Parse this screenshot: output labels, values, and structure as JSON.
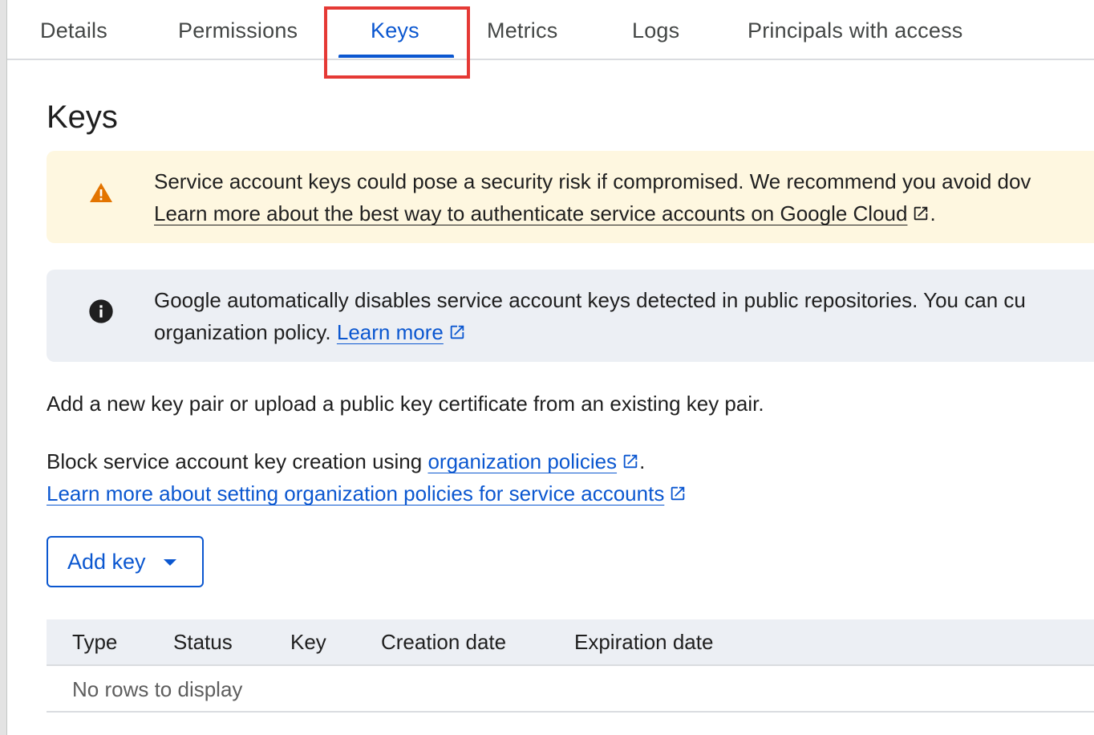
{
  "tabs": [
    {
      "label": "Details"
    },
    {
      "label": "Permissions"
    },
    {
      "label": "Keys"
    },
    {
      "label": "Metrics"
    },
    {
      "label": "Logs"
    },
    {
      "label": "Principals with access"
    }
  ],
  "active_tab": "Keys",
  "page_title": "Keys",
  "warning_banner": {
    "icon": "warning-icon",
    "text": "Service account keys could pose a security risk if compromised. We recommend you avoid dov",
    "link_text": "Learn more about the best way to authenticate service accounts on Google Cloud",
    "after_link": "."
  },
  "info_banner": {
    "icon": "info-icon",
    "text": "Google automatically disables service account keys detected in public repositories. You can cu",
    "text2": "organization policy.",
    "link_text": "Learn more"
  },
  "description": "Add a new key pair or upload a public key certificate from an existing key pair.",
  "block_text": "Block service account key creation using",
  "org_policies_link": "organization policies",
  "block_after": ".",
  "learn_more_policies_link": "Learn more about setting organization policies for service accounts",
  "add_key_button": "Add key",
  "table": {
    "columns": [
      "Type",
      "Status",
      "Key",
      "Creation date",
      "Expiration date"
    ],
    "empty_text": "No rows to display"
  },
  "colors": {
    "accent": "#0b57d0",
    "warning_bg": "#fef7e0",
    "warning_icon": "#e37400",
    "info_bg": "#eceff4",
    "highlight": "#e53935"
  }
}
